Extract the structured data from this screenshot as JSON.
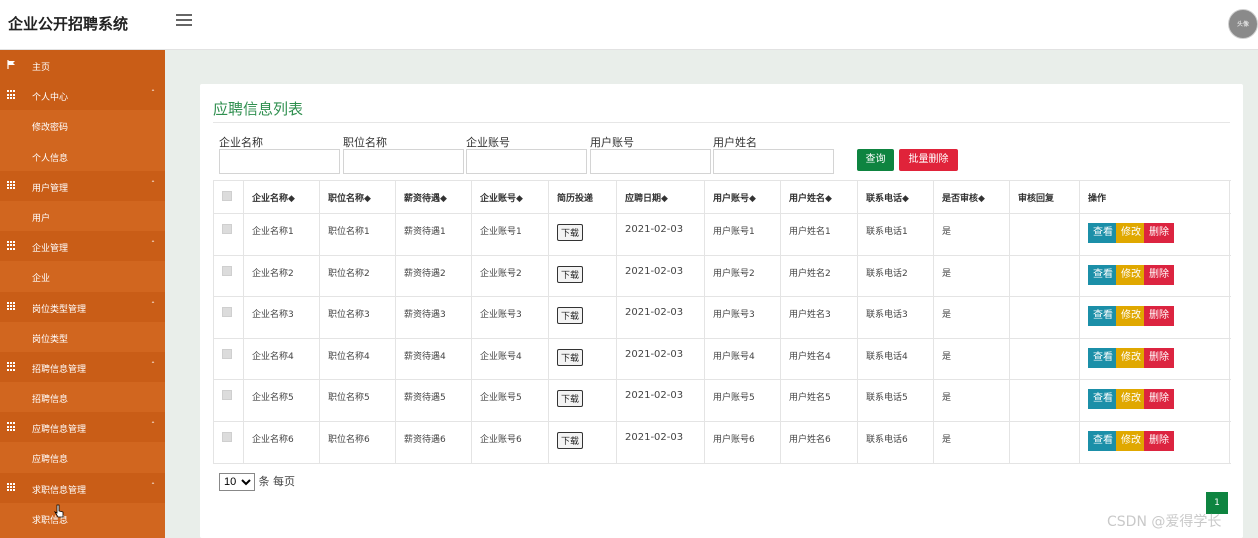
{
  "app": {
    "title": "企业公开招聘系统",
    "avatar_text": "头像"
  },
  "sidebar": {
    "items": [
      {
        "label": "主页",
        "type": "home"
      },
      {
        "label": "个人中心",
        "type": "group"
      },
      {
        "label": "修改密码",
        "type": "sub"
      },
      {
        "label": "个人信息",
        "type": "sub"
      },
      {
        "label": "用户管理",
        "type": "group"
      },
      {
        "label": "用户",
        "type": "sub"
      },
      {
        "label": "企业管理",
        "type": "group"
      },
      {
        "label": "企业",
        "type": "sub"
      },
      {
        "label": "岗位类型管理",
        "type": "group"
      },
      {
        "label": "岗位类型",
        "type": "sub"
      },
      {
        "label": "招聘信息管理",
        "type": "group"
      },
      {
        "label": "招聘信息",
        "type": "sub"
      },
      {
        "label": "应聘信息管理",
        "type": "group"
      },
      {
        "label": "应聘信息",
        "type": "sub"
      },
      {
        "label": "求职信息管理",
        "type": "group"
      },
      {
        "label": "求职信息",
        "type": "sub"
      }
    ]
  },
  "panel": {
    "title": "应聘信息列表"
  },
  "search": {
    "fields": [
      "企业名称",
      "职位名称",
      "企业账号",
      "用户账号",
      "用户姓名"
    ],
    "search_label": "查询",
    "batch_delete_label": "批量删除"
  },
  "table": {
    "headers": [
      "企业名称◆",
      "职位名称◆",
      "薪资待遇◆",
      "企业账号◆",
      "简历投递",
      "应聘日期◆",
      "用户账号◆",
      "用户姓名◆",
      "联系电话◆",
      "是否审核◆",
      "审核回复",
      "操作"
    ],
    "download_label": "下载",
    "actions": {
      "view": "查看",
      "edit": "修改",
      "delete": "删除"
    },
    "rows": [
      {
        "company": "企业名称1",
        "position": "职位名称1",
        "salary": "薪资待遇1",
        "company_account": "企业账号1",
        "date": "2021-02-03",
        "user_account": "用户账号1",
        "user_name": "用户姓名1",
        "phone": "联系电话1",
        "reviewed": "是",
        "reply": ""
      },
      {
        "company": "企业名称2",
        "position": "职位名称2",
        "salary": "薪资待遇2",
        "company_account": "企业账号2",
        "date": "2021-02-03",
        "user_account": "用户账号2",
        "user_name": "用户姓名2",
        "phone": "联系电话2",
        "reviewed": "是",
        "reply": ""
      },
      {
        "company": "企业名称3",
        "position": "职位名称3",
        "salary": "薪资待遇3",
        "company_account": "企业账号3",
        "date": "2021-02-03",
        "user_account": "用户账号3",
        "user_name": "用户姓名3",
        "phone": "联系电话3",
        "reviewed": "是",
        "reply": ""
      },
      {
        "company": "企业名称4",
        "position": "职位名称4",
        "salary": "薪资待遇4",
        "company_account": "企业账号4",
        "date": "2021-02-03",
        "user_account": "用户账号4",
        "user_name": "用户姓名4",
        "phone": "联系电话4",
        "reviewed": "是",
        "reply": ""
      },
      {
        "company": "企业名称5",
        "position": "职位名称5",
        "salary": "薪资待遇5",
        "company_account": "企业账号5",
        "date": "2021-02-03",
        "user_account": "用户账号5",
        "user_name": "用户姓名5",
        "phone": "联系电话5",
        "reviewed": "是",
        "reply": ""
      },
      {
        "company": "企业名称6",
        "position": "职位名称6",
        "salary": "薪资待遇6",
        "company_account": "企业账号6",
        "date": "2021-02-03",
        "user_account": "用户账号6",
        "user_name": "用户姓名6",
        "phone": "联系电话6",
        "reviewed": "是",
        "reply": ""
      }
    ]
  },
  "pagination": {
    "page_size": "10",
    "per_page_label": "条 每页",
    "current_page": "1"
  },
  "watermark": "CSDN @爱得学长",
  "colors": {
    "sidebar": "#d1661f",
    "accent": "#2f8f4f",
    "primary_button": "#0e8440",
    "danger": "#e0233a",
    "view": "#1b8fa8",
    "edit": "#e0a800"
  }
}
